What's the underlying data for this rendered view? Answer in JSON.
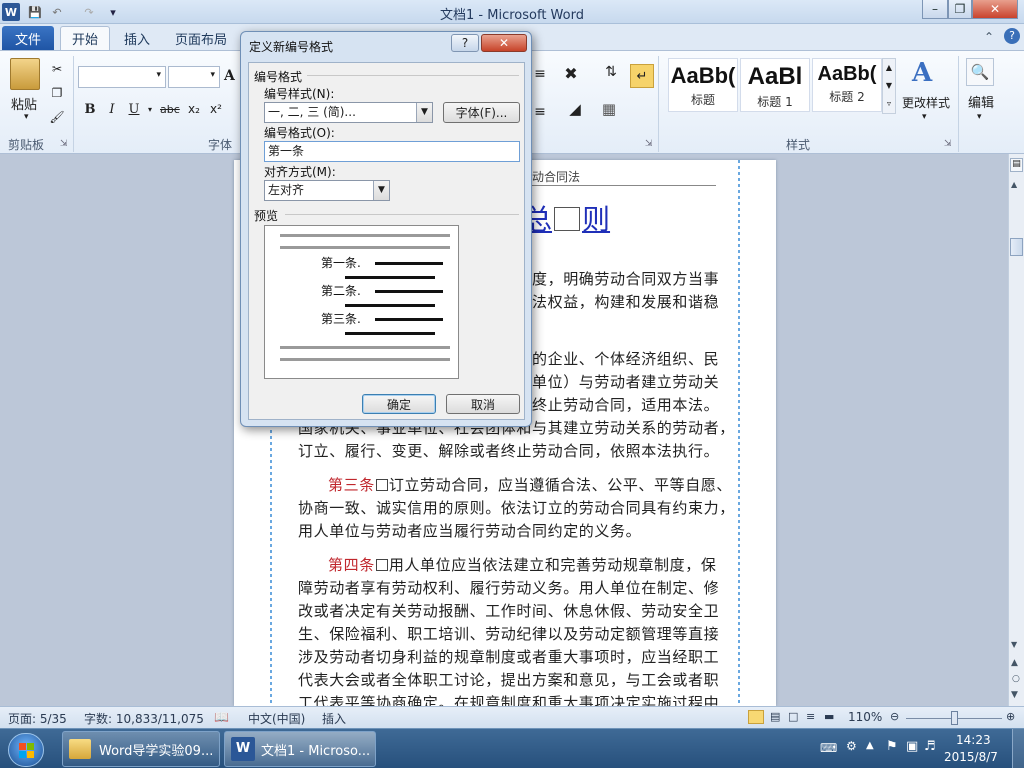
{
  "window": {
    "title": "文档1 - Microsoft Word"
  },
  "ribbon": {
    "tabs": [
      {
        "label": "文件"
      },
      {
        "label": "开始"
      },
      {
        "label": "插入"
      },
      {
        "label": "页面布局"
      }
    ],
    "paste_label": "粘贴",
    "clipboard_group": "剪贴板",
    "font_group": "字体",
    "styles_group": "样式",
    "styles": [
      {
        "preview": "AaBb(",
        "name": "标题"
      },
      {
        "preview": "AaBl",
        "name": "标题 1"
      },
      {
        "preview": "AaBb(",
        "name": "标题 2"
      }
    ],
    "change_styles": "更改样式",
    "edit": "编辑"
  },
  "dialog": {
    "title": "定义新编号格式",
    "section_label": "编号格式",
    "style_label": "编号样式(N):",
    "style_value": "一, 二, 三 (简)...",
    "font_button": "字体(F)...",
    "format_label": "编号格式(O):",
    "format_value": "第一条",
    "align_label": "对齐方式(M):",
    "align_value": "左对齐",
    "preview_label": "预览",
    "preview_items": [
      "第一条.",
      "第二条.",
      "第三条."
    ],
    "ok": "确定",
    "cancel": "取消"
  },
  "document": {
    "header_fragment": "动合同法",
    "heading_fragment": "总",
    "heading_end": "则",
    "para1_lines": [
      "度，明确劳动合同双方当事",
      "法权益，构建和发展和谐稳"
    ],
    "para2_lines": [
      "的企业、个体经济组织、民",
      "单位）与劳动者建立劳动关",
      "终止劳动合同，适用本法。",
      "国家机关、事业单位、社会团体和与其建立劳动关系的劳动者，",
      "订立、履行、变更、解除或者终止劳动合同，依照本法执行。"
    ],
    "art3_label": "第三条",
    "art3_lines": [
      "订立劳动合同，应当遵循合法、公平、平等自愿、",
      "协商一致、诚实信用的原则。依法订立的劳动合同具有约束力，",
      "用人单位与劳动者应当履行劳动合同约定的义务。"
    ],
    "art4_label": "第四条",
    "art4_lines": [
      "用人单位应当依法建立和完善劳动规章制度，保",
      "障劳动者享有劳动权利、履行劳动义务。用人单位在制定、修",
      "改或者决定有关劳动报酬、工作时间、休息休假、劳动安全卫",
      "生、保险福利、职工培训、劳动纪律以及劳动定额管理等直接",
      "涉及劳动者切身利益的规章制度或者重大事项时，应当经职工",
      "代表大会或者全体职工讨论，提出方案和意见，与工会或者职",
      "工代表平等协商确定。在规章制度和重大事项决定实施过程中"
    ]
  },
  "status": {
    "page": "页面: 5/35",
    "words": "字数: 10,833/11,075",
    "lang": "中文(中国)",
    "mode": "插入",
    "zoom": "110%"
  },
  "taskbar": {
    "items": [
      {
        "label": "Word导学实验09..."
      },
      {
        "label": "文档1 - Microso..."
      }
    ],
    "time": "14:23",
    "date": "2015/8/7"
  }
}
